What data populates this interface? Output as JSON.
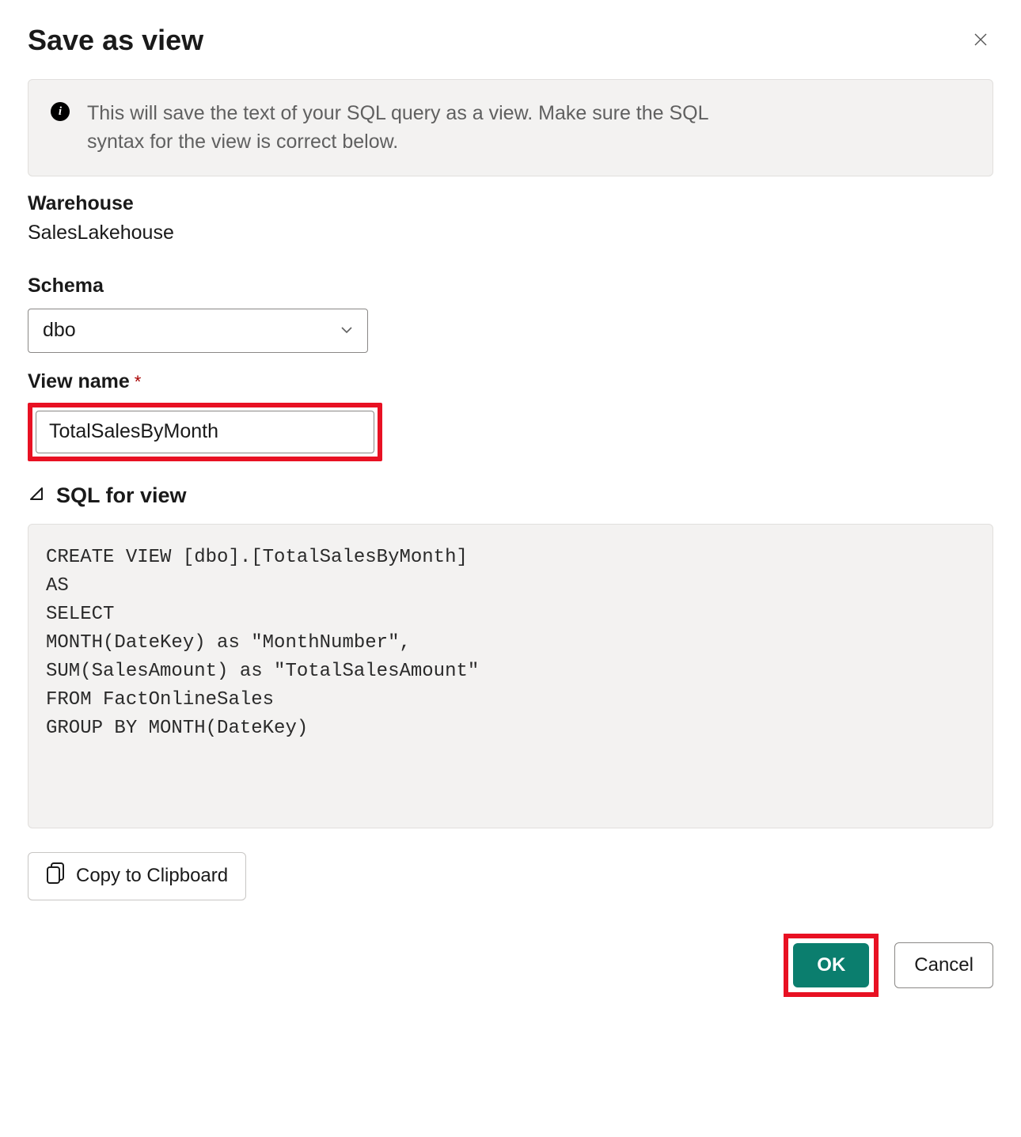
{
  "dialog": {
    "title": "Save as view"
  },
  "info": {
    "text": "This will save the text of your SQL query as a view. Make sure the SQL syntax for the view is correct below."
  },
  "warehouse": {
    "label": "Warehouse",
    "value": "SalesLakehouse"
  },
  "schema": {
    "label": "Schema",
    "selected": "dbo"
  },
  "viewName": {
    "label": "View name",
    "value": "TotalSalesByMonth"
  },
  "sql": {
    "label": "SQL for view",
    "content": "CREATE VIEW [dbo].[TotalSalesByMonth]\nAS\nSELECT\nMONTH(DateKey) as \"MonthNumber\",\nSUM(SalesAmount) as \"TotalSalesAmount\"\nFROM FactOnlineSales\nGROUP BY MONTH(DateKey)"
  },
  "buttons": {
    "copy": "Copy to Clipboard",
    "ok": "OK",
    "cancel": "Cancel"
  }
}
